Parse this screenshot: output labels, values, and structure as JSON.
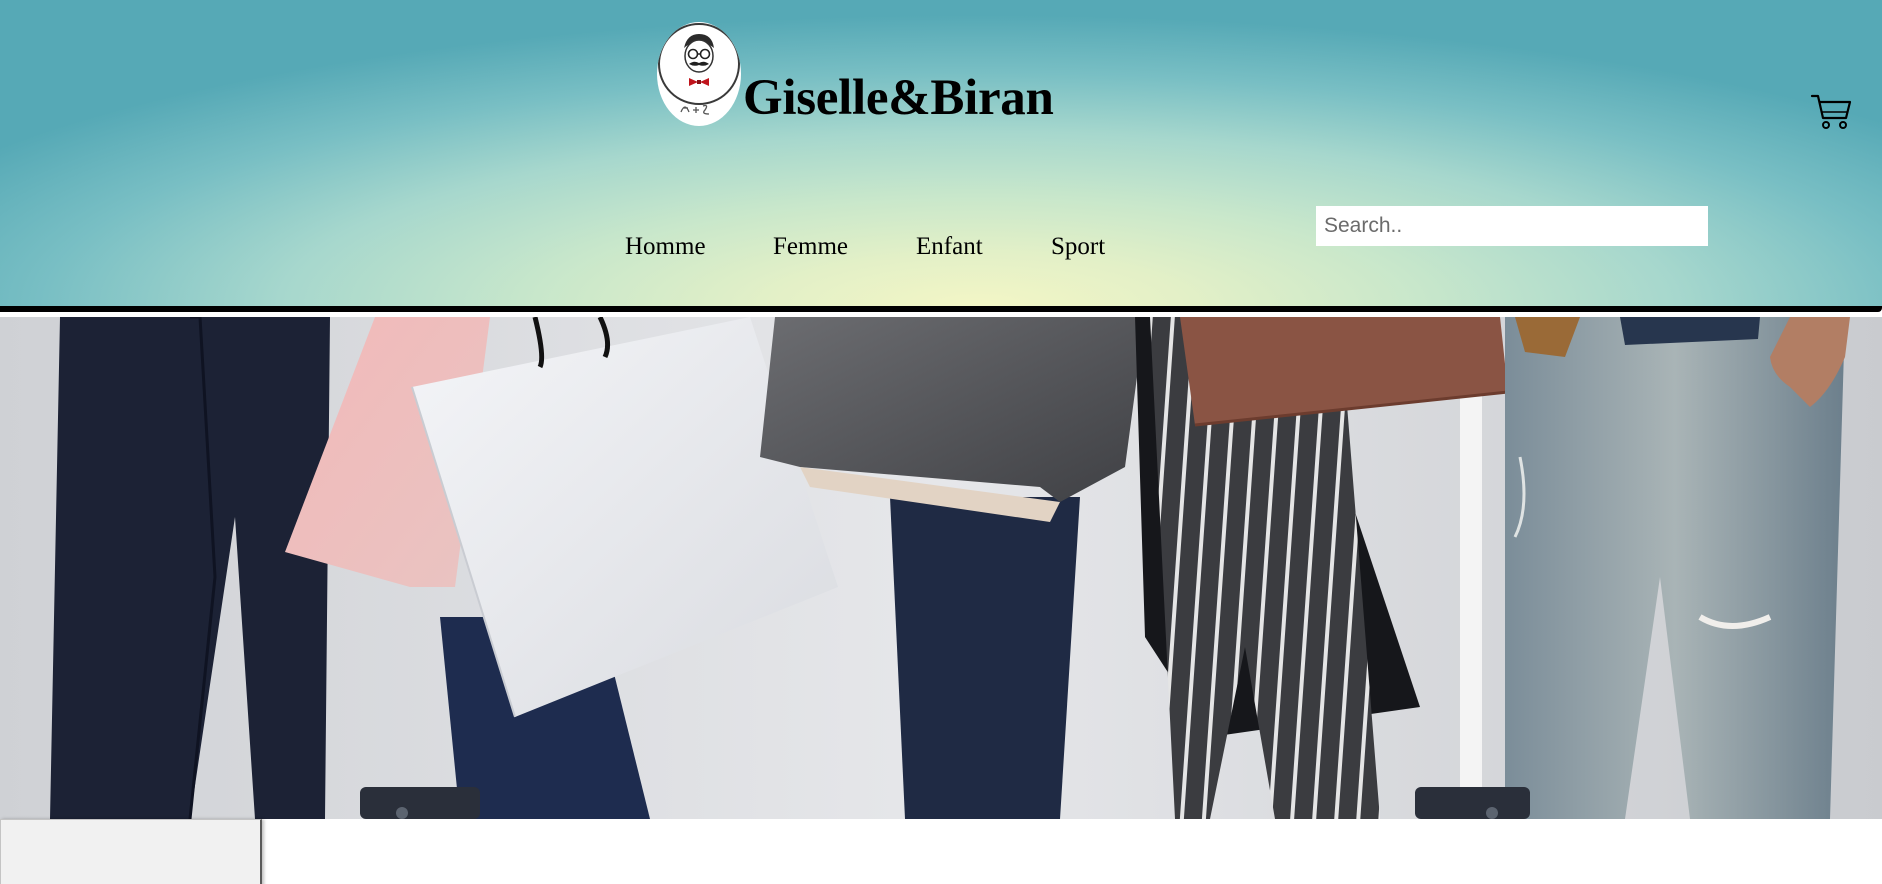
{
  "brand": {
    "name": "Giselle&Biran",
    "logo_icon": "mustache-man-logo-icon"
  },
  "nav": {
    "items": [
      {
        "label": "Homme"
      },
      {
        "label": "Femme"
      },
      {
        "label": "Enfant"
      },
      {
        "label": "Sport"
      }
    ]
  },
  "search": {
    "placeholder": "Search..",
    "value": ""
  },
  "cart": {
    "icon": "cart-icon"
  },
  "hero": {
    "image_subject": "shopping-bags-photo"
  },
  "colors": {
    "header_gradient_center": "#f3f6c6",
    "header_gradient_edge": "#56a9b6",
    "header_border": "#000000",
    "panel_background": "#f1f1f1"
  }
}
